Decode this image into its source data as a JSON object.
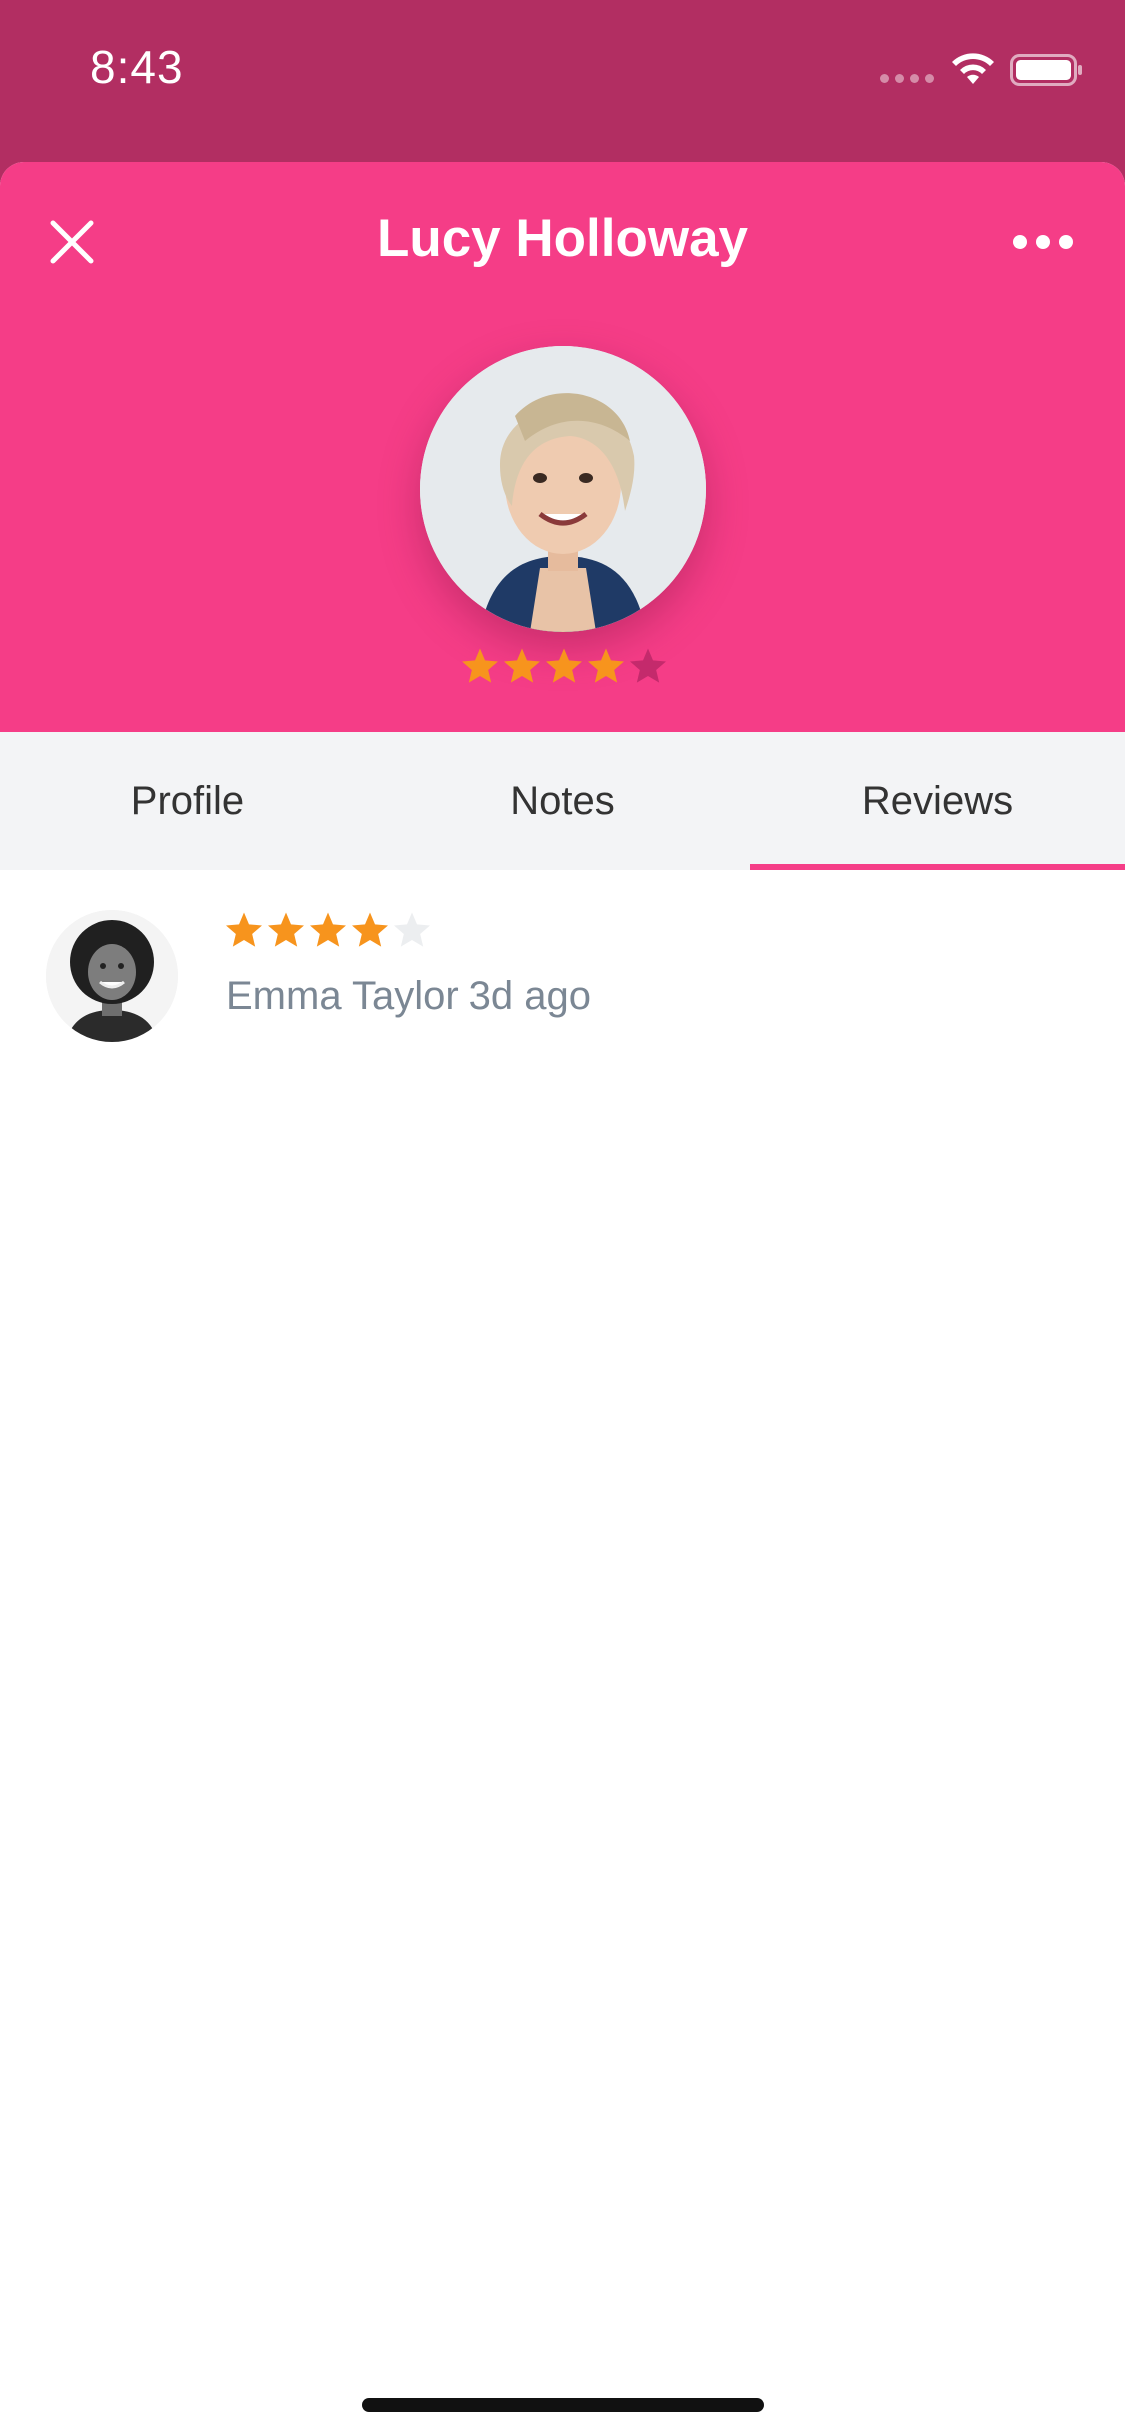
{
  "status_bar": {
    "time": "8:43",
    "wifi_icon": "wifi-icon",
    "battery_icon": "battery-icon"
  },
  "header": {
    "title": "Lucy Holloway",
    "close_icon": "close-icon",
    "more_icon": "more-horizontal-icon",
    "rating": 4,
    "rating_max": 5,
    "colors": {
      "background": "#f53d87",
      "status_bar": "#b22e62",
      "star_filled": "#f7941d",
      "star_empty_header": "#c42a6c"
    }
  },
  "tabs": [
    {
      "label": "Profile",
      "active": false
    },
    {
      "label": "Notes",
      "active": false
    },
    {
      "label": "Reviews",
      "active": true
    }
  ],
  "reviews": [
    {
      "reviewer": "Emma Taylor",
      "time": "3d ago",
      "rating": 4,
      "rating_max": 5
    }
  ]
}
